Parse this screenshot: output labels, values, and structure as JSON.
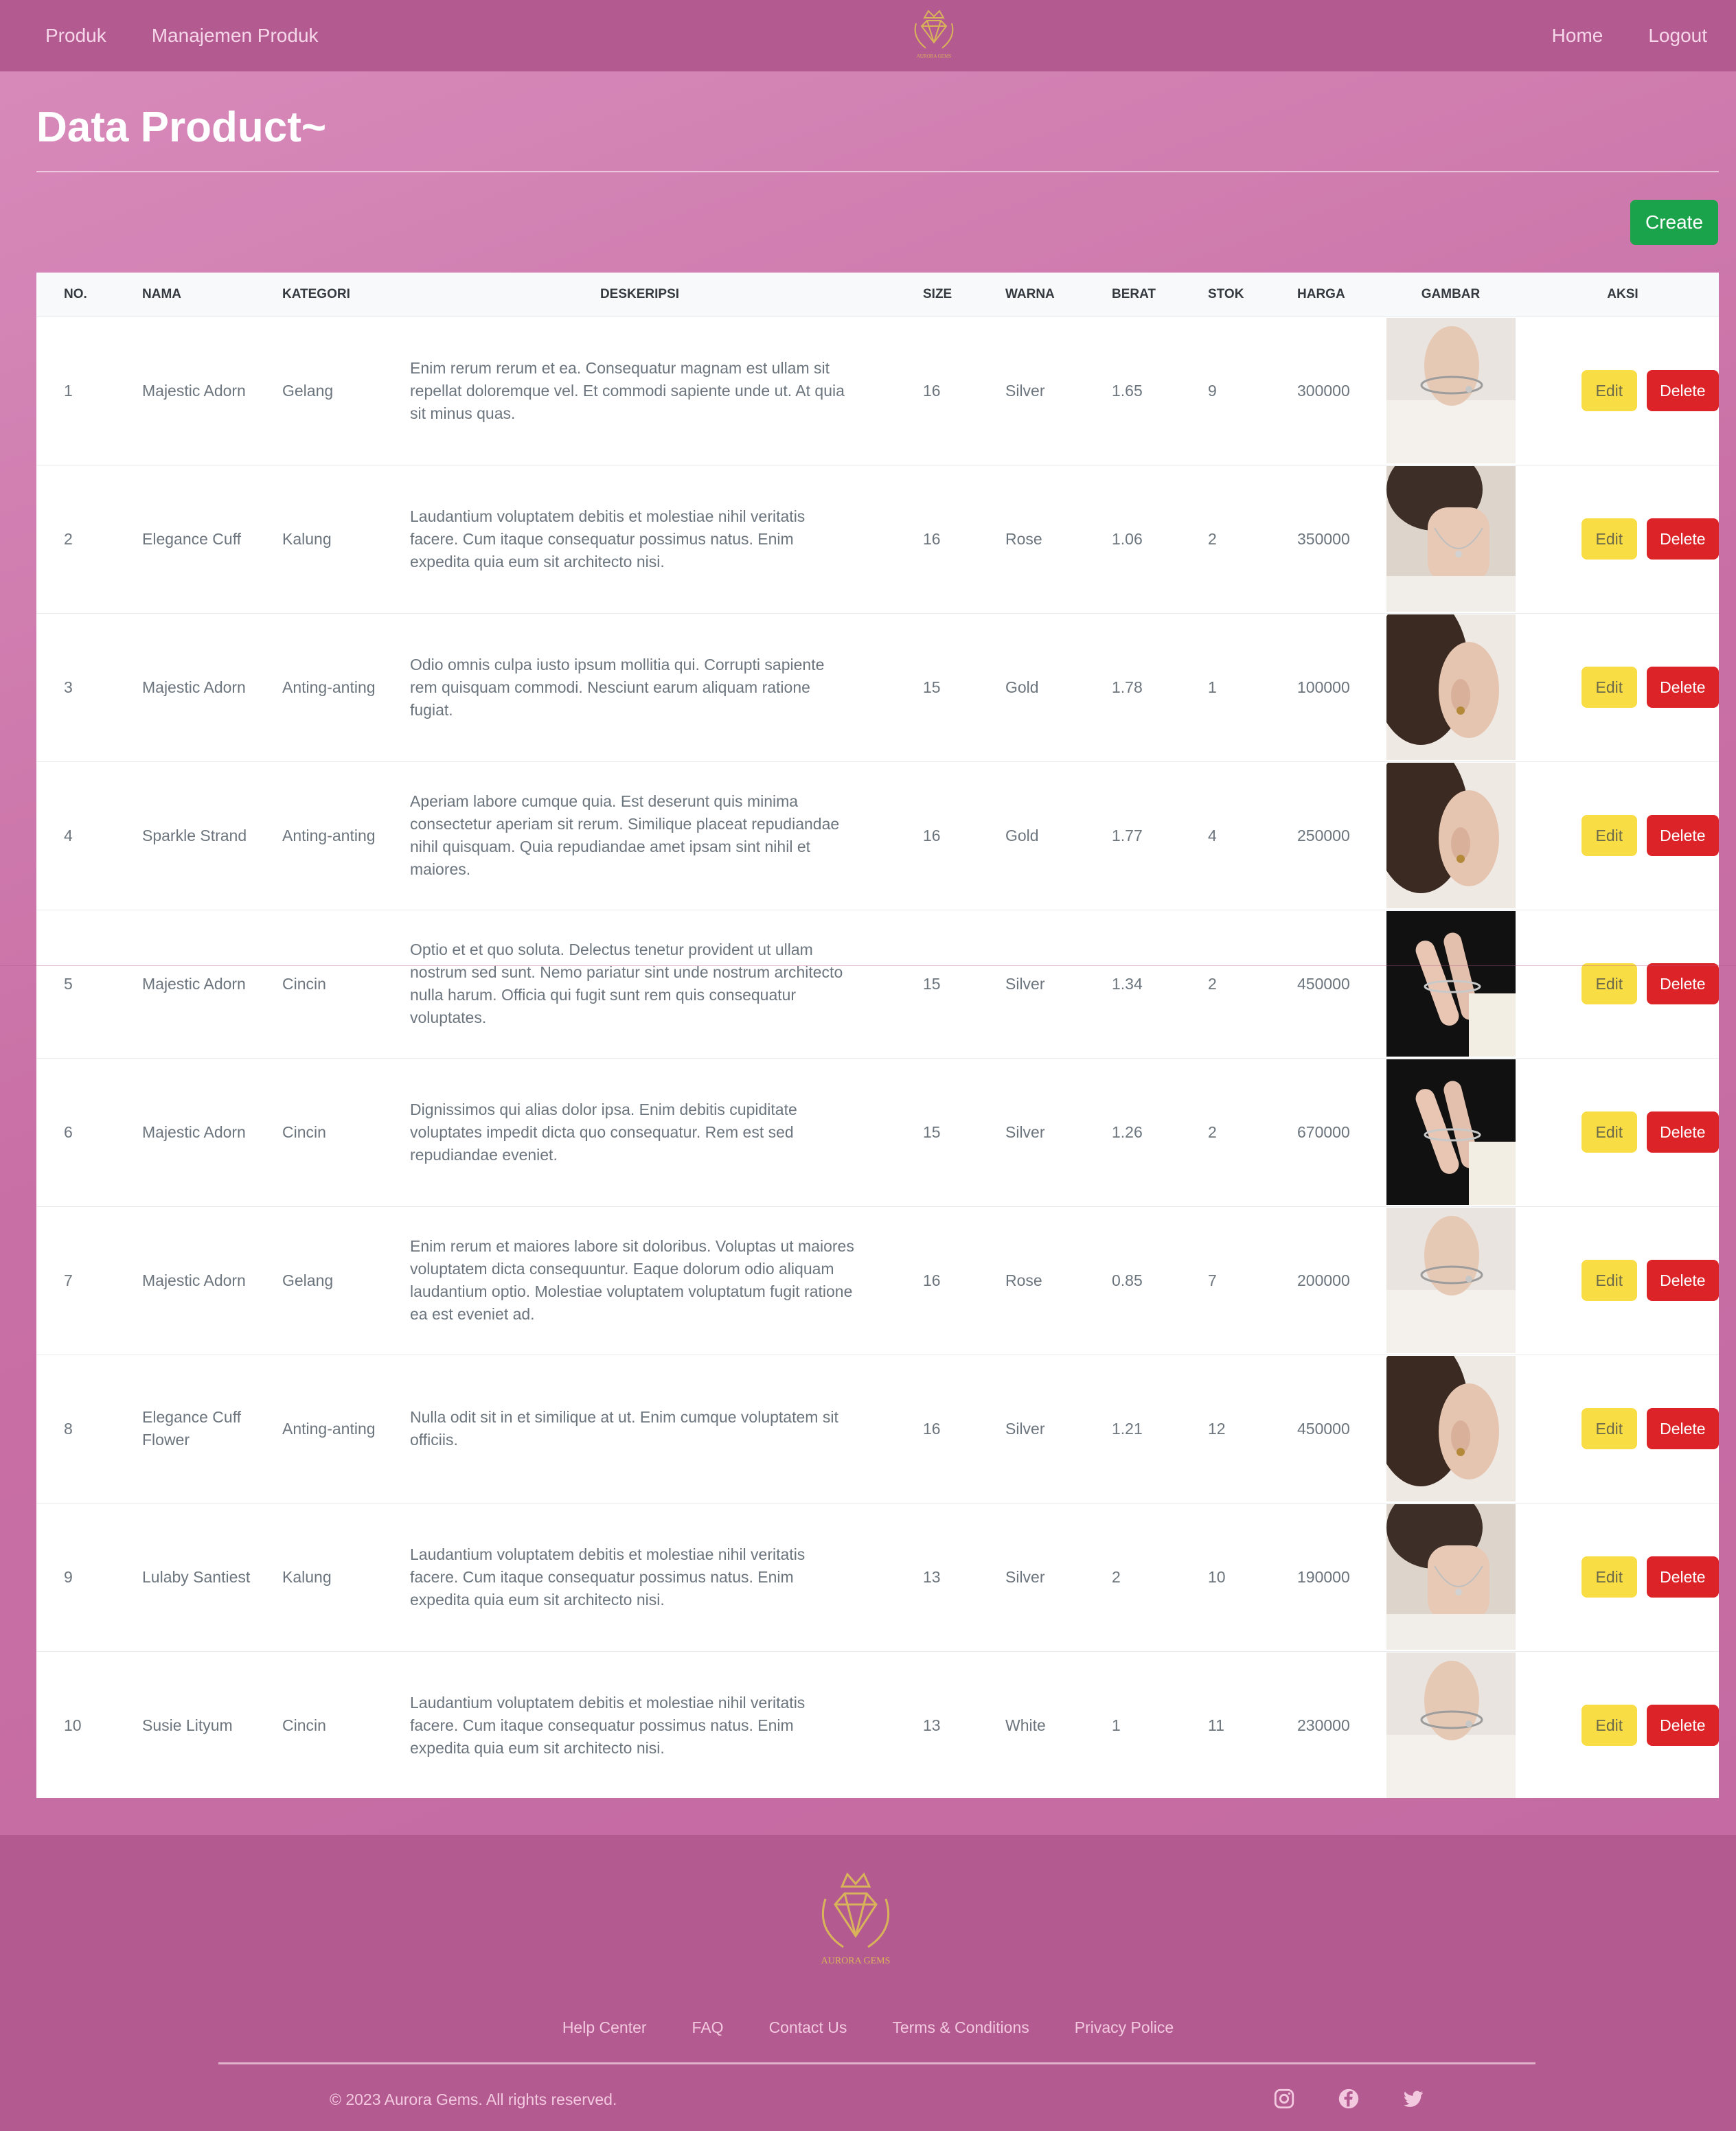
{
  "nav": {
    "left": [
      "Produk",
      "Manajemen Produk"
    ],
    "right": [
      "Home",
      "Logout"
    ],
    "brand": "AURORA GEMS"
  },
  "page": {
    "title": "Data Product~",
    "create_label": "Create"
  },
  "table": {
    "headers": [
      "NO.",
      "NAMA",
      "KATEGORI",
      "DESKERIPSI",
      "SIZE",
      "WARNA",
      "BERAT",
      "STOK",
      "HARGA",
      "GAMBAR",
      "AKSI"
    ],
    "edit_label": "Edit",
    "delete_label": "Delete",
    "rows": [
      {
        "no": "1",
        "nama": "Majestic Adorn",
        "kategori": "Gelang",
        "desc": "Enim rerum rerum et ea. Consequatur magnam est ullam sit repellat doloremque vel. Et commodi sapiente unde ut. At quia sit minus quas.",
        "size": "16",
        "warna": "Silver",
        "berat": "1.65",
        "stok": "9",
        "harga": "300000",
        "img": "bracelet-photo"
      },
      {
        "no": "2",
        "nama": "Elegance Cuff",
        "kategori": "Kalung",
        "desc": "Laudantium voluptatem debitis et molestiae nihil veritatis facere. Cum itaque consequatur possimus natus. Enim expedita quia eum sit architecto nisi.",
        "size": "16",
        "warna": "Rose",
        "berat": "1.06",
        "stok": "2",
        "harga": "350000",
        "img": "necklace-photo"
      },
      {
        "no": "3",
        "nama": "Majestic Adorn",
        "kategori": "Anting-anting",
        "desc": "Odio omnis culpa iusto ipsum mollitia qui. Corrupti sapiente rem quisquam commodi. Nesciunt earum aliquam ratione fugiat.",
        "size": "15",
        "warna": "Gold",
        "berat": "1.78",
        "stok": "1",
        "harga": "100000",
        "img": "earring-photo"
      },
      {
        "no": "4",
        "nama": "Sparkle Strand",
        "kategori": "Anting-anting",
        "desc": "Aperiam labore cumque quia. Est deserunt quis minima consectetur aperiam sit rerum. Similique placeat repudiandae nihil quisquam. Quia repudiandae amet ipsam sint nihil et maiores.",
        "size": "16",
        "warna": "Gold",
        "berat": "1.77",
        "stok": "4",
        "harga": "250000",
        "img": "earring-photo"
      },
      {
        "no": "5",
        "nama": "Majestic Adorn",
        "kategori": "Cincin",
        "desc": "Optio et et quo soluta. Delectus tenetur provident ut ullam nostrum sed sunt. Nemo pariatur sint unde nostrum architecto nulla harum. Officia qui fugit sunt rem quis consequatur voluptates.",
        "size": "15",
        "warna": "Silver",
        "berat": "1.34",
        "stok": "2",
        "harga": "450000",
        "img": "ring-photo"
      },
      {
        "no": "6",
        "nama": "Majestic Adorn",
        "kategori": "Cincin",
        "desc": "Dignissimos qui alias dolor ipsa. Enim debitis cupiditate voluptates impedit dicta quo consequatur. Rem est sed repudiandae eveniet.",
        "size": "15",
        "warna": "Silver",
        "berat": "1.26",
        "stok": "2",
        "harga": "670000",
        "img": "ring-photo"
      },
      {
        "no": "7",
        "nama": "Majestic Adorn",
        "kategori": "Gelang",
        "desc": "Enim rerum et maiores labore sit doloribus. Voluptas ut maiores voluptatem dicta consequuntur. Eaque dolorum odio aliquam laudantium optio. Molestiae voluptatem voluptatum fugit ratione ea est eveniet ad.",
        "size": "16",
        "warna": "Rose",
        "berat": "0.85",
        "stok": "7",
        "harga": "200000",
        "img": "bracelet-photo"
      },
      {
        "no": "8",
        "nama": "Elegance Cuff Flower",
        "kategori": "Anting-anting",
        "desc": "Nulla odit sit in et similique at ut. Enim cumque voluptatem sit officiis.",
        "size": "16",
        "warna": "Silver",
        "berat": "1.21",
        "stok": "12",
        "harga": "450000",
        "img": "earring-photo"
      },
      {
        "no": "9",
        "nama": "Lulaby Santiest",
        "kategori": "Kalung",
        "desc": "Laudantium voluptatem debitis et molestiae nihil veritatis facere. Cum itaque consequatur possimus natus. Enim expedita quia eum sit architecto nisi.",
        "size": "13",
        "warna": "Silver",
        "berat": "2",
        "stok": "10",
        "harga": "190000",
        "img": "necklace-photo"
      },
      {
        "no": "10",
        "nama": "Susie Lityum",
        "kategori": "Cincin",
        "desc": "Laudantium voluptatem debitis et molestiae nihil veritatis facere. Cum itaque consequatur possimus natus. Enim expedita quia eum sit architecto nisi.",
        "size": "13",
        "warna": "White",
        "berat": "1",
        "stok": "11",
        "harga": "230000",
        "img": "bracelet-photo"
      }
    ]
  },
  "footer": {
    "links": [
      "Help Center",
      "FAQ",
      "Contact Us",
      "Terms & Conditions",
      "Privacy Police"
    ],
    "copyright": "© 2023 Aurora Gems. All rights reserved.",
    "social_icons": [
      "instagram-icon",
      "facebook-icon",
      "twitter-icon"
    ]
  },
  "colors": {
    "navbar": "#b35a90",
    "create": "#1aa34a",
    "edit": "#f9dd45",
    "delete": "#dc2428",
    "gold": "#d9b35a"
  }
}
